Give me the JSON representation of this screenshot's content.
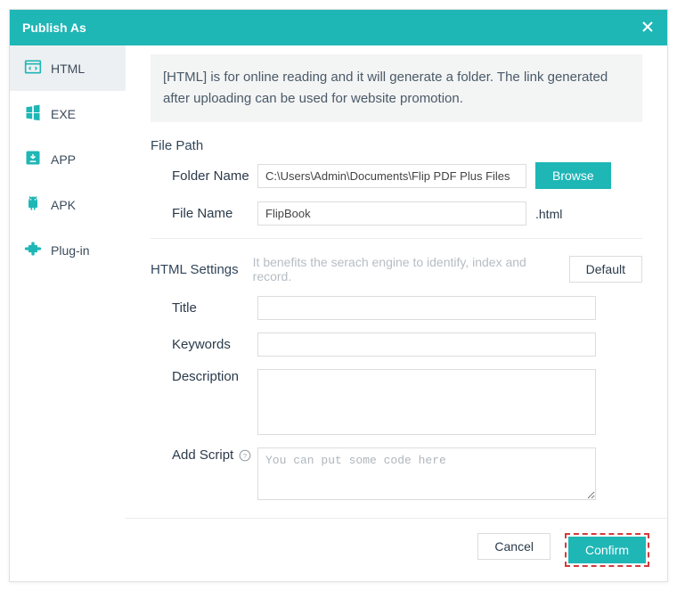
{
  "title": "Publish As",
  "sidebar": [
    {
      "label": "HTML"
    },
    {
      "label": "EXE"
    },
    {
      "label": "APP"
    },
    {
      "label": "APK"
    },
    {
      "label": "Plug-in"
    }
  ],
  "description": "[HTML] is for online reading and it will generate a folder. The link generated after uploading can be used for website promotion.",
  "labels": {
    "filePath": "File Path",
    "folderName": "Folder Name",
    "fileName": "File Name",
    "browse": "Browse",
    "htmlSettings": "HTML Settings",
    "hint": "It benefits the serach engine to identify, index and record.",
    "default": "Default",
    "title": "Title",
    "keywords": "Keywords",
    "description": "Description",
    "addScript": "Add Script",
    "scriptPlaceholder": "You can put some code here",
    "cancel": "Cancel",
    "confirm": "Confirm",
    "extension": ".html"
  },
  "values": {
    "folderName": "C:\\Users\\Admin\\Documents\\Flip PDF Plus Files",
    "fileName": "FlipBook",
    "title": "",
    "keywords": "",
    "description": "",
    "script": ""
  },
  "colors": {
    "accent": "#1fb6b6",
    "highlight": "#d33b3b"
  }
}
